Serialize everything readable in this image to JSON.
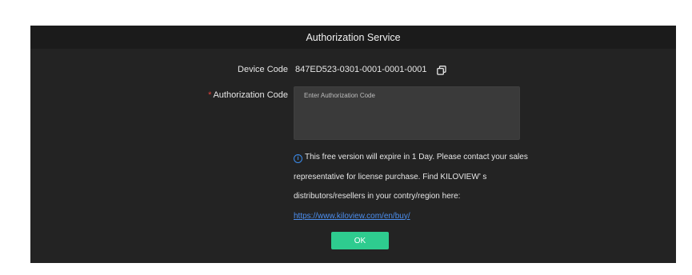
{
  "dialog": {
    "title": "Authorization Service"
  },
  "device_code": {
    "label": "Device Code",
    "value": "847ED523-0301-0001-0001-0001",
    "copy_icon": "copy-icon"
  },
  "authorization_code": {
    "required_mark": "*",
    "label": "Authorization Code",
    "placeholder": "Enter Authorization Code",
    "value": ""
  },
  "notice": {
    "icon": "info-icon",
    "text": "This free version will expire in 1 Day. Please contact your sales representative for license purchase. Find KILOVIEW’ s distributors/resellers in your contry/region here: ",
    "link_text": "https://www.kiloview.com/en/buy/"
  },
  "ok_button": {
    "label": "OK"
  },
  "colors": {
    "dialog_bg": "#232323",
    "header_bg": "#1b1b1b",
    "input_bg": "#3a3a3a",
    "accent_green": "#2ecc8f",
    "link_blue": "#4c8ff0",
    "required_red": "#e0403a"
  }
}
